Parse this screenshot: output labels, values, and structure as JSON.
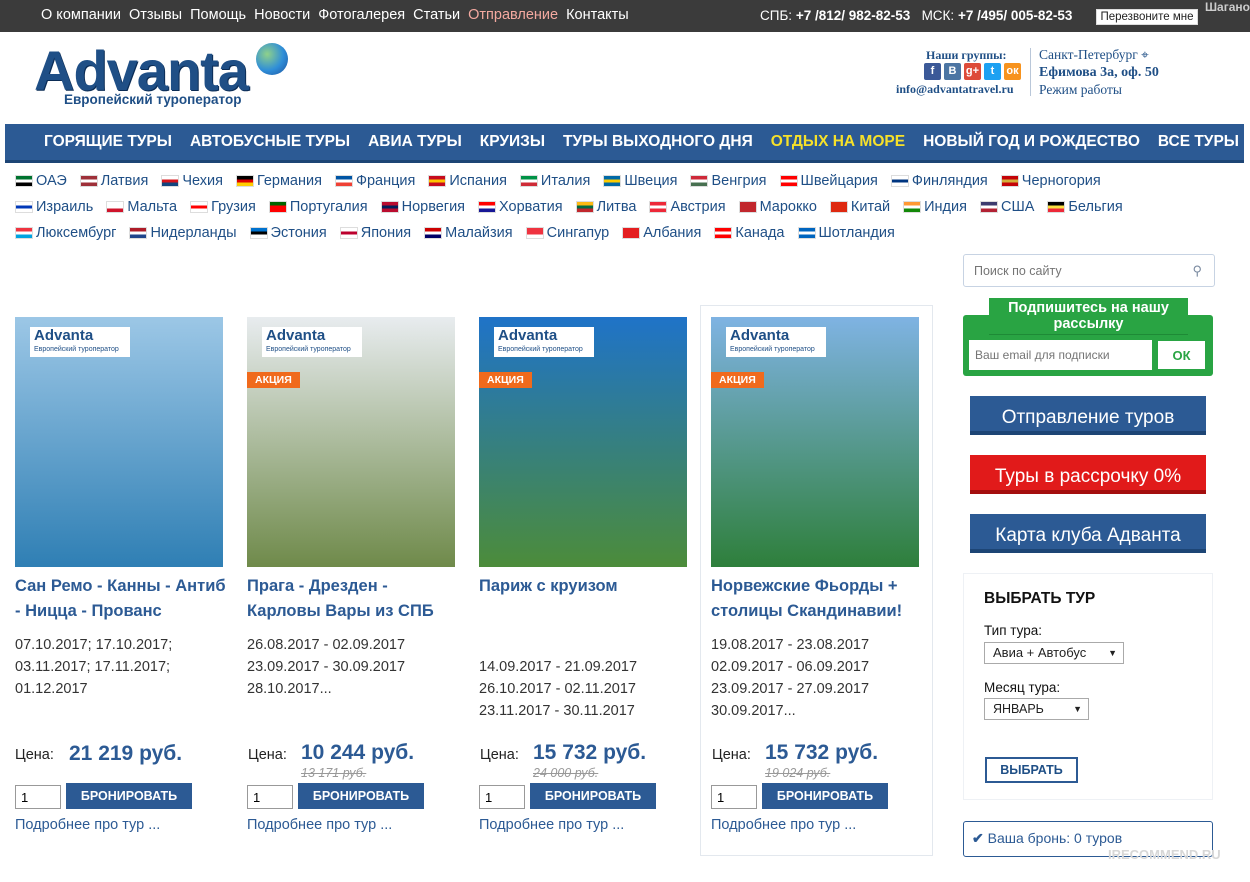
{
  "topbar": {
    "nav": [
      {
        "label": "О компании",
        "active": false
      },
      {
        "label": "Отзывы",
        "active": false
      },
      {
        "label": "Помощь",
        "active": false
      },
      {
        "label": "Новости",
        "active": false
      },
      {
        "label": "Фотогалерея",
        "active": false
      },
      {
        "label": "Статьи",
        "active": false
      },
      {
        "label": "Отправление",
        "active": true
      },
      {
        "label": "Контакты",
        "active": false
      }
    ],
    "spb_label": "СПБ:",
    "spb_phone": "+7 /812/ 982-82-53",
    "msk_label": "МСК:",
    "msk_phone": "+7 /495/ 005-82-53",
    "callback": "Перезвоните мне",
    "watermark": "Шагано"
  },
  "header": {
    "logo": "Advanta",
    "logo_sub": "Европейский туроператор",
    "groups_title": "Наши группы:",
    "social": [
      {
        "icon": "facebook-icon",
        "glyph": "f",
        "color": "#3b5998"
      },
      {
        "icon": "vk-icon",
        "glyph": "В",
        "color": "#4c75a3"
      },
      {
        "icon": "google-plus-icon",
        "glyph": "g+",
        "color": "#dd4b39"
      },
      {
        "icon": "twitter-icon",
        "glyph": "t",
        "color": "#1da1f2"
      },
      {
        "icon": "odnoklassniki-icon",
        "glyph": "ок",
        "color": "#f7931e"
      }
    ],
    "email": "info@advantatravel.ru",
    "city": "Санкт-Петербург",
    "address": "Ефимова 3а, оф. 50",
    "hours": "Режим работы"
  },
  "mainnav": [
    {
      "label": "ГОРЯЩИЕ ТУРЫ",
      "highlight": false
    },
    {
      "label": "АВТОБУСНЫЕ ТУРЫ",
      "highlight": false
    },
    {
      "label": "АВИА ТУРЫ",
      "highlight": false
    },
    {
      "label": "КРУИЗЫ",
      "highlight": false
    },
    {
      "label": "ТУРЫ ВЫХОДНОГО ДНЯ",
      "highlight": false
    },
    {
      "label": "ОТДЫХ НА МОРЕ",
      "highlight": true
    },
    {
      "label": "НОВЫЙ ГОД И РОЖДЕСТВО",
      "highlight": false
    },
    {
      "label": "ВСЕ ТУРЫ",
      "highlight": false
    }
  ],
  "countries": [
    [
      {
        "name": "ОАЭ",
        "flag": [
          "#00732f",
          "#ffffff",
          "#000000"
        ]
      },
      {
        "name": "Латвия",
        "flag": [
          "#9e3039",
          "#ffffff",
          "#9e3039"
        ]
      },
      {
        "name": "Чехия",
        "flag": [
          "#ffffff",
          "#d7141a",
          "#11457e"
        ]
      },
      {
        "name": "Германия",
        "flag": [
          "#000000",
          "#dd0000",
          "#ffce00"
        ]
      },
      {
        "name": "Франция",
        "flag": [
          "#0055a4",
          "#ffffff",
          "#ef4135"
        ]
      },
      {
        "name": "Испания",
        "flag": [
          "#c60b1e",
          "#ffc400",
          "#c60b1e"
        ]
      },
      {
        "name": "Италия",
        "flag": [
          "#009246",
          "#ffffff",
          "#ce2b37"
        ]
      },
      {
        "name": "Швеция",
        "flag": [
          "#006aa7",
          "#fecc00",
          "#006aa7"
        ]
      },
      {
        "name": "Венгрия",
        "flag": [
          "#ce2939",
          "#ffffff",
          "#477050"
        ]
      },
      {
        "name": "Швейцария",
        "flag": [
          "#ff0000",
          "#ffffff",
          "#ff0000"
        ]
      },
      {
        "name": "Финляндия",
        "flag": [
          "#ffffff",
          "#003580",
          "#ffffff"
        ]
      },
      {
        "name": "Черногория",
        "flag": [
          "#c40308",
          "#d4af3a",
          "#c40308"
        ]
      }
    ],
    [
      {
        "name": "Израиль",
        "flag": [
          "#ffffff",
          "#0038b8",
          "#ffffff"
        ]
      },
      {
        "name": "Мальта",
        "flag": [
          "#ffffff",
          "#ffffff",
          "#cf142b"
        ]
      },
      {
        "name": "Грузия",
        "flag": [
          "#ffffff",
          "#ff0000",
          "#ffffff"
        ]
      },
      {
        "name": "Португалия",
        "flag": [
          "#006600",
          "#ff0000",
          "#ff0000"
        ]
      },
      {
        "name": "Норвегия",
        "flag": [
          "#ba0c2f",
          "#00205b",
          "#ba0c2f"
        ]
      },
      {
        "name": "Хорватия",
        "flag": [
          "#ff0000",
          "#ffffff",
          "#171796"
        ]
      },
      {
        "name": "Литва",
        "flag": [
          "#fdb913",
          "#006a44",
          "#c1272d"
        ]
      },
      {
        "name": "Австрия",
        "flag": [
          "#ed2939",
          "#ffffff",
          "#ed2939"
        ]
      },
      {
        "name": "Марокко",
        "flag": [
          "#c1272d",
          "#c1272d",
          "#c1272d"
        ]
      },
      {
        "name": "Китай",
        "flag": [
          "#de2910",
          "#de2910",
          "#de2910"
        ]
      },
      {
        "name": "Индия",
        "flag": [
          "#ff9933",
          "#ffffff",
          "#138808"
        ]
      },
      {
        "name": "США",
        "flag": [
          "#3c3b6e",
          "#ffffff",
          "#b22234"
        ]
      },
      {
        "name": "Бельгия",
        "flag": [
          "#000000",
          "#fae042",
          "#ed2939"
        ]
      }
    ],
    [
      {
        "name": "Люксембург",
        "flag": [
          "#ef3340",
          "#ffffff",
          "#00a3e0"
        ]
      },
      {
        "name": "Нидерланды",
        "flag": [
          "#ae1c28",
          "#ffffff",
          "#21468b"
        ]
      },
      {
        "name": "Эстония",
        "flag": [
          "#0072ce",
          "#000000",
          "#ffffff"
        ]
      },
      {
        "name": "Япония",
        "flag": [
          "#ffffff",
          "#bc002d",
          "#ffffff"
        ]
      },
      {
        "name": "Малайзия",
        "flag": [
          "#cc0001",
          "#ffffff",
          "#010066"
        ]
      },
      {
        "name": "Сингапур",
        "flag": [
          "#ef3340",
          "#ef3340",
          "#ffffff"
        ]
      },
      {
        "name": "Албания",
        "flag": [
          "#e41e20",
          "#e41e20",
          "#e41e20"
        ]
      },
      {
        "name": "Канада",
        "flag": [
          "#ff0000",
          "#ffffff",
          "#ff0000"
        ]
      },
      {
        "name": "Шотландия",
        "flag": [
          "#0065bf",
          "#ffffff",
          "#0065bf"
        ]
      }
    ]
  ],
  "tours": [
    {
      "title": "Сан Ремо - Канны - Антиб - Ницца - Прованс",
      "dates": [
        "07.10.2017; 17.10.2017;",
        "03.11.2017; 17.11.2017;",
        "01.12.2017"
      ],
      "price_label": "Цена:",
      "price": "21 219 руб.",
      "old_price": "",
      "sale": "",
      "qty": "1",
      "book": "БРОНИРОВАТЬ",
      "more": "Подробнее про тур ...",
      "img_top": "#9cc7e6",
      "img_bottom": "#2f7fb4"
    },
    {
      "title": "Прага - Дрезден - Карловы Вары из СПБ",
      "dates": [
        "26.08.2017 - 02.09.2017",
        "23.09.2017 - 30.09.2017",
        "28.10.2017..."
      ],
      "price_label": "Цена:",
      "price": "10 244 руб.",
      "old_price": "13 171 руб.",
      "sale": "АКЦИЯ",
      "qty": "1",
      "book": "БРОНИРОВАТЬ",
      "more": "Подробнее про тур ...",
      "img_top": "#e8ecef",
      "img_bottom": "#6f8a4a"
    },
    {
      "title": "Париж с круизом",
      "dates": [
        "",
        "14.09.2017 - 21.09.2017",
        "26.10.2017 - 02.11.2017",
        "23.11.2017 - 30.11.2017"
      ],
      "price_label": "Цена:",
      "price": "15 732 руб.",
      "old_price": "24 000 руб.",
      "sale": "АКЦИЯ",
      "qty": "1",
      "book": "БРОНИРОВАТЬ",
      "more": "Подробнее про тур ...",
      "img_top": "#1f73c8",
      "img_bottom": "#4c8c3a"
    },
    {
      "title": "Норвежские Фьорды + столицы Скандинавии!",
      "dates": [
        "19.08.2017 - 23.08.2017",
        "02.09.2017 - 06.09.2017",
        "23.09.2017 - 27.09.2017",
        "30.09.2017..."
      ],
      "price_label": "Цена:",
      "price": "15 732 руб.",
      "old_price": "19 024 руб.",
      "sale": "АКЦИЯ",
      "qty": "1",
      "book": "БРОНИРОВАТЬ",
      "more": "Подробнее про тур ...",
      "img_top": "#7fb3e3",
      "img_bottom": "#2e7f3b"
    }
  ],
  "badge_logo": "Advanta",
  "badge_sub": "Европейский туроператор",
  "sidebar": {
    "search_placeholder": "Поиск по сайту",
    "subscribe_title": "Подпишитесь на нашу рассылку",
    "subscribe_placeholder": "Ваш email для подписки",
    "subscribe_ok": "ОК",
    "btn_depart": "Отправление туров",
    "btn_credit": "Туры в рассрочку 0%",
    "btn_club": "Карта клуба Адванта",
    "choose_title": "ВЫБРАТЬ ТУР",
    "type_label": "Тип тура:",
    "type_value": "Авиа + Автобус",
    "month_label": "Месяц тура:",
    "month_value": "ЯНВАРЬ",
    "choose_button": "ВЫБРАТЬ",
    "booking": "Ваша бронь: 0 туров"
  },
  "watermark": "IRECOMMEND.RU"
}
